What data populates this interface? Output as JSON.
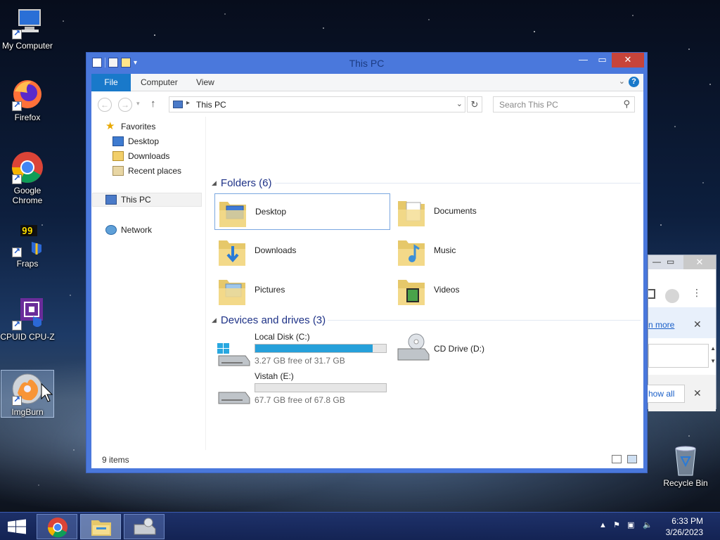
{
  "desktop": {
    "icons": [
      {
        "label": "My Computer"
      },
      {
        "label": "Firefox"
      },
      {
        "label": "Google Chrome"
      },
      {
        "label": "Fraps"
      },
      {
        "label": "CPUID CPU-Z"
      },
      {
        "label": "ImgBurn"
      },
      {
        "label": "Recycle Bin"
      }
    ]
  },
  "background_window": {
    "link_text": "n more",
    "show_all_text": "how all"
  },
  "explorer": {
    "title": "This PC",
    "ribbon": {
      "file": "File",
      "computer": "Computer",
      "view": "View"
    },
    "address": {
      "location": "This PC"
    },
    "search": {
      "placeholder": "Search This PC"
    },
    "nav": {
      "favorites": "Favorites",
      "desktop": "Desktop",
      "downloads": "Downloads",
      "recent": "Recent places",
      "thispc": "This PC",
      "network": "Network"
    },
    "folders_header": "Folders (6)",
    "folders": [
      {
        "name": "Desktop"
      },
      {
        "name": "Documents"
      },
      {
        "name": "Downloads"
      },
      {
        "name": "Music"
      },
      {
        "name": "Pictures"
      },
      {
        "name": "Videos"
      }
    ],
    "devices_header": "Devices and drives (3)",
    "drives": [
      {
        "name": "Local Disk (C:)",
        "free": "3.27 GB free of 31.7 GB",
        "used_fraction": 0.897
      },
      {
        "name": "Vistah (E:)",
        "free": "67.7 GB free of 67.8 GB",
        "used_fraction": 0.0
      },
      {
        "name": "CD Drive (D:)"
      }
    ],
    "status": {
      "count": "9 items"
    }
  },
  "taskbar": {
    "time": "6:33 PM",
    "date": "3/26/2023"
  },
  "colors": {
    "window_frame": "#4a78dc",
    "file_tab": "#1979ca",
    "drive_bar": "#26a0da",
    "close_button": "#c7443a",
    "group_header": "#1e3287"
  }
}
